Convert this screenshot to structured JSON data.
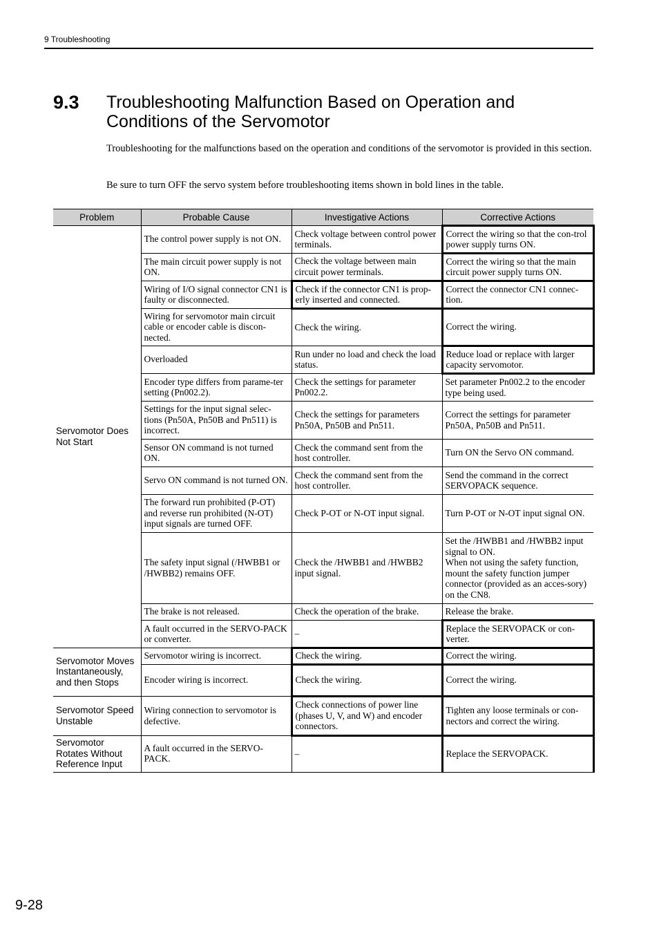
{
  "header": {
    "running_head": "9  Troubleshooting"
  },
  "section": {
    "number": "9.3",
    "title": "Troubleshooting Malfunction Based on Operation and Conditions of the Servomotor"
  },
  "paragraphs": [
    "Troubleshooting for the malfunctions based on the operation and conditions of the servomotor is provided in this section.",
    "Be sure to turn OFF the servo system before troubleshooting items shown in bold lines in the table."
  ],
  "table": {
    "headers": [
      "Problem",
      "Probable Cause",
      "Investigative Actions",
      "Corrective Actions"
    ],
    "groups": [
      {
        "problem": "Servomotor Does Not Start",
        "rows": [
          {
            "cause": "The control power supply is not ON.",
            "investigate": "Check voltage between control power terminals.",
            "correct": "Correct the wiring so that the con-trol power supply turns ON.",
            "bold_investigate": false,
            "bold_correct": true
          },
          {
            "cause": "The main circuit power supply is not ON.",
            "investigate": "Check the voltage between main circuit power terminals.",
            "correct": "Correct the wiring so that the main circuit power supply turns ON.",
            "bold_investigate": false,
            "bold_correct": true
          },
          {
            "cause": "Wiring of I/O signal connector CN1 is faulty or disconnected.",
            "investigate": "Check if the connector CN1 is prop-erly inserted and connected.",
            "correct": "Correct the connector CN1 connec-tion.",
            "bold_investigate": true,
            "bold_correct": true
          },
          {
            "cause": "Wiring for servomotor main circuit cable or encoder cable is discon-nected.",
            "investigate": "Check the wiring.",
            "correct": "Correct the wiring.",
            "bold_investigate": false,
            "bold_correct": true
          },
          {
            "cause": "Overloaded",
            "investigate": "Run under no load and check the load status.",
            "correct": "Reduce load or replace with larger capacity servomotor.",
            "bold_investigate": false,
            "bold_correct": true
          },
          {
            "cause": "Encoder type differs from parame-ter setting (Pn002.2).",
            "investigate": "Check the settings for parameter Pn002.2.",
            "correct": "Set parameter Pn002.2 to the encoder type being used.",
            "bold_investigate": false,
            "bold_correct": false
          },
          {
            "cause": "Settings for the input signal selec-tions (Pn50A, Pn50B and Pn511) is incorrect.",
            "investigate": "Check the settings for parameters Pn50A, Pn50B and Pn511.",
            "correct": "Correct the settings for parameter Pn50A, Pn50B and Pn511.",
            "bold_investigate": false,
            "bold_correct": false
          },
          {
            "cause": "Sensor ON command is not turned ON.",
            "investigate": "Check the command sent from the host controller.",
            "correct": "Turn ON the Servo ON command.",
            "bold_investigate": false,
            "bold_correct": false
          },
          {
            "cause": "Servo ON command is not turned ON.",
            "investigate": "Check the command sent from the host controller.",
            "correct": "Send the command in the correct SERVOPACK sequence.",
            "bold_investigate": false,
            "bold_correct": false
          },
          {
            "cause": "The forward run prohibited (P-OT) and reverse run prohibited (N-OT) input signals are turned OFF.",
            "investigate": "Check P-OT or N-OT input signal.",
            "correct": "Turn P-OT or N-OT input signal ON.",
            "bold_investigate": false,
            "bold_correct": false
          },
          {
            "cause": "The safety input signal (/HWBB1 or /HWBB2) remains OFF.",
            "investigate": "Check the /HWBB1 and /HWBB2 input signal.",
            "correct": "Set the /HWBB1 and /HWBB2 input signal to ON.\nWhen not using the safety function, mount the safety function jumper connector (provided as an acces-sory) on the CN8.",
            "bold_investigate": false,
            "bold_correct": false
          },
          {
            "cause": "The brake is not released.",
            "investigate": "Check the operation of the brake.",
            "correct": "Release the brake.",
            "bold_investigate": false,
            "bold_correct": false
          },
          {
            "cause": "A fault occurred in the SERVO-PACK or converter.",
            "investigate": "–",
            "correct": "Replace the SERVOPACK or con-verter.",
            "bold_investigate": false,
            "bold_correct": true
          }
        ]
      },
      {
        "problem": "Servomotor Moves Instantaneously, and then Stops",
        "rows": [
          {
            "cause": "Servomotor wiring is incorrect.",
            "investigate": "Check the wiring.",
            "correct": "Correct the wiring.",
            "bold_investigate": true,
            "bold_correct": true
          },
          {
            "cause": "Encoder wiring is incorrect.",
            "investigate": "Check the wiring.",
            "correct": "Correct the wiring.",
            "bold_investigate": true,
            "bold_correct": true
          }
        ]
      },
      {
        "problem": "Servomotor Speed Unstable",
        "rows": [
          {
            "cause": "Wiring connection to servomotor is defective.",
            "investigate": "Check connections of power line (phases U, V, and W) and encoder connectors.",
            "correct": "Tighten any loose terminals or con-nectors and correct the wiring.",
            "bold_investigate": true,
            "bold_correct": true
          }
        ]
      },
      {
        "problem": "Servomotor Rotates Without Reference Input",
        "rows": [
          {
            "cause": "A fault occurred in the SERVO-PACK.",
            "investigate": "–",
            "correct": "Replace the SERVOPACK.",
            "bold_investigate": false,
            "bold_correct": true
          }
        ]
      }
    ]
  },
  "footer": {
    "page_number": "9-28"
  }
}
